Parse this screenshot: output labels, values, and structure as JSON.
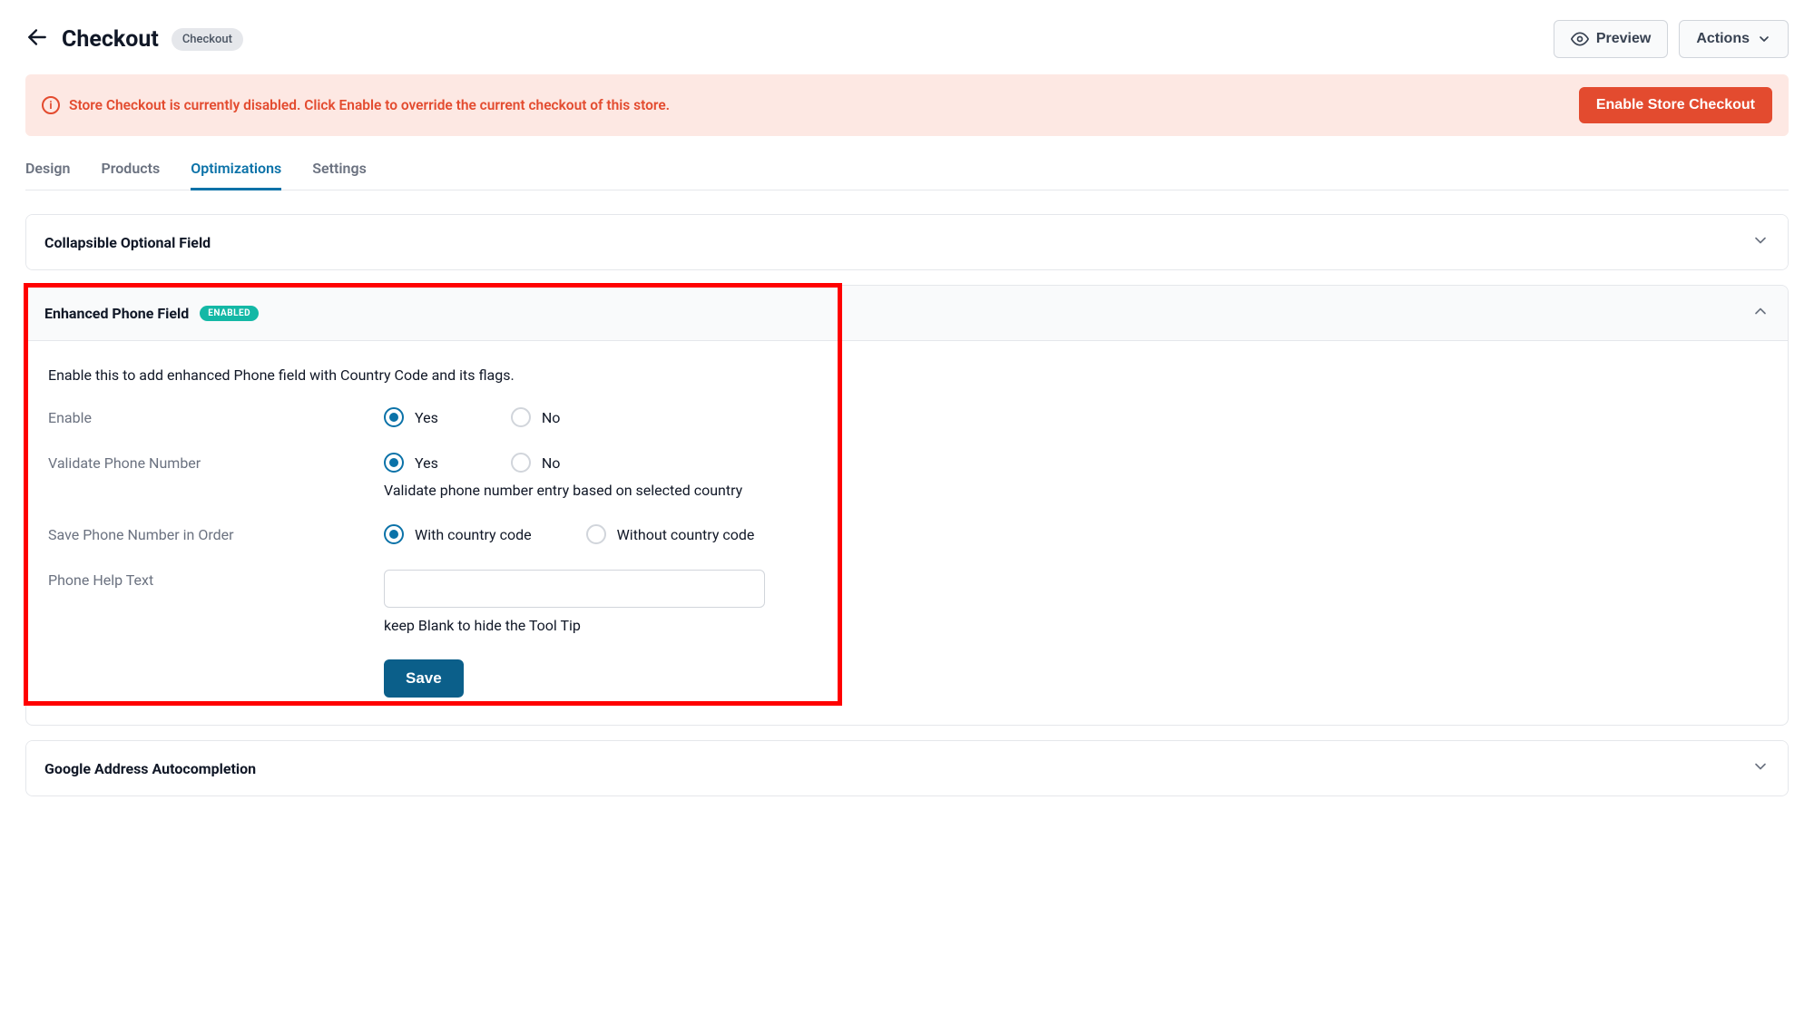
{
  "header": {
    "title": "Checkout",
    "badge": "Checkout",
    "preview_label": "Preview",
    "actions_label": "Actions"
  },
  "alert": {
    "message": "Store Checkout is currently disabled. Click Enable to override the current checkout of this store.",
    "button_label": "Enable Store Checkout"
  },
  "tabs": {
    "design": "Design",
    "products": "Products",
    "optimizations": "Optimizations",
    "settings": "Settings"
  },
  "accordions": {
    "collapsible": {
      "title": "Collapsible Optional Field"
    },
    "enhanced_phone": {
      "title": "Enhanced Phone Field",
      "badge": "ENABLED",
      "description": "Enable this to add enhanced Phone field with Country Code and its flags.",
      "enable_label": "Enable",
      "validate_label": "Validate Phone Number",
      "validate_help": "Validate phone number entry based on selected country",
      "save_order_label": "Save Phone Number in Order",
      "help_text_label": "Phone Help Text",
      "help_text_help": "keep Blank to hide the Tool Tip",
      "options": {
        "yes": "Yes",
        "no": "No",
        "with_code": "With country code",
        "without_code": "Without country code"
      },
      "save_button": "Save",
      "phone_help_value": ""
    },
    "google_address": {
      "title": "Google Address Autocompletion"
    }
  }
}
